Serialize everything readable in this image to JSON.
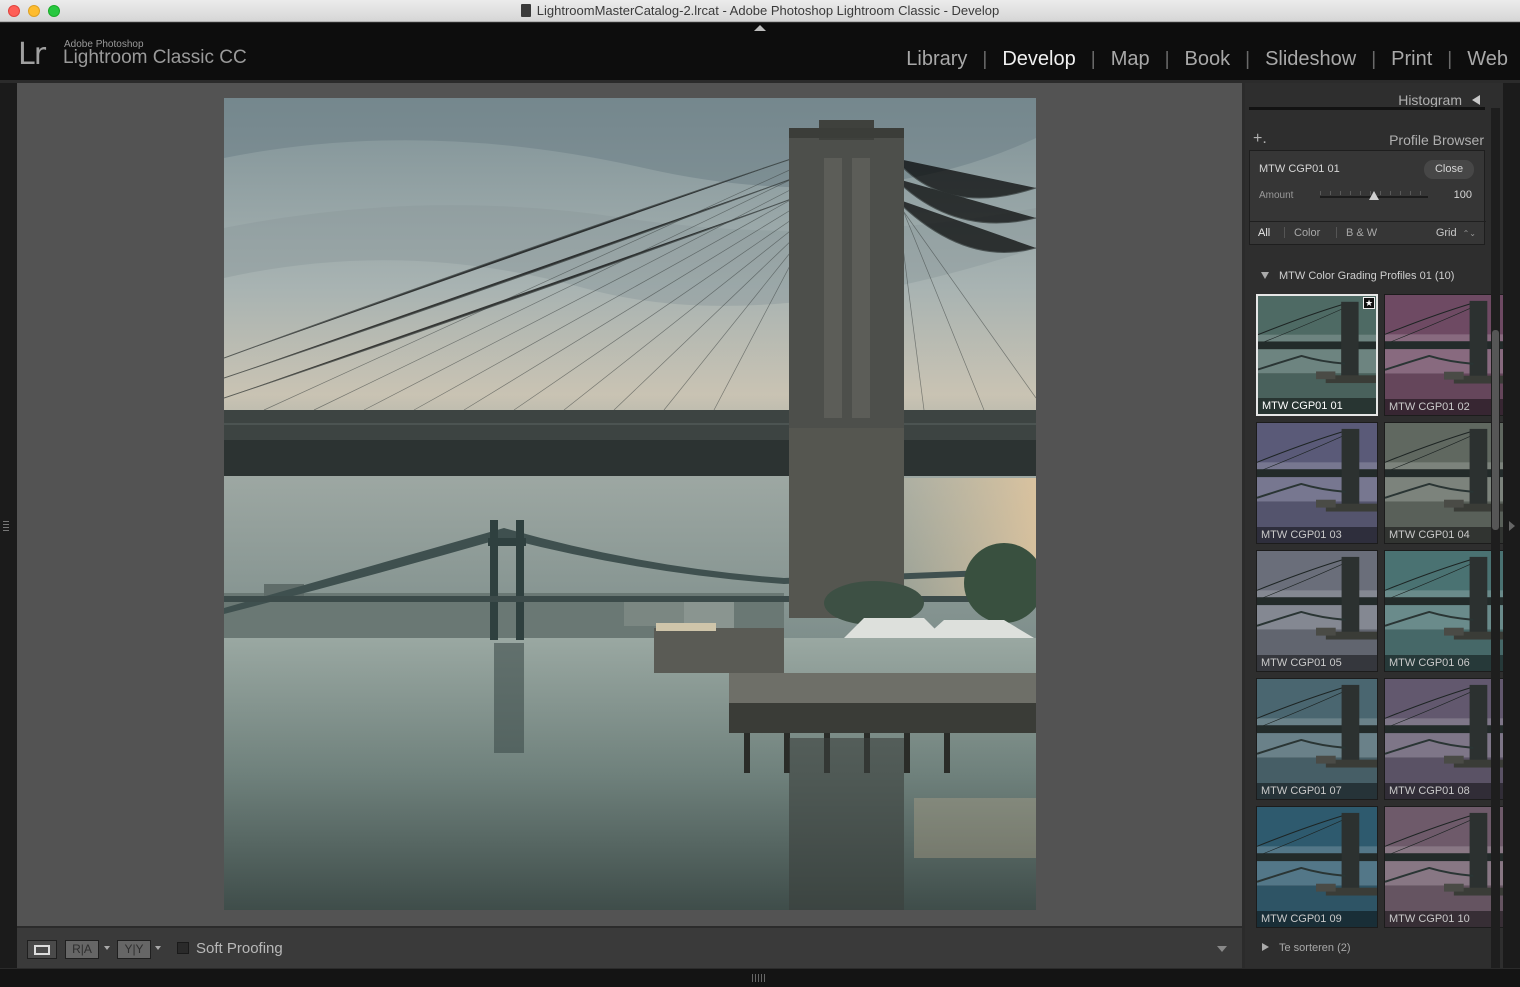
{
  "window": {
    "title": "LightroomMasterCatalog-2.lrcat - Adobe Photoshop Lightroom Classic - Develop"
  },
  "header": {
    "logo": "Lr",
    "brand_small": "Adobe Photoshop",
    "brand_big": "Lightroom Classic CC",
    "modules": [
      {
        "label": "Library",
        "active": false
      },
      {
        "label": "Develop",
        "active": true
      },
      {
        "label": "Map",
        "active": false
      },
      {
        "label": "Book",
        "active": false
      },
      {
        "label": "Slideshow",
        "active": false
      },
      {
        "label": "Print",
        "active": false
      },
      {
        "label": "Web",
        "active": false
      }
    ]
  },
  "toolbar": {
    "ra_label": "R|A",
    "yy_label": "Y|Y",
    "soft_proofing_label": "Soft Proofing",
    "soft_proofing_checked": false
  },
  "right_panel": {
    "histogram_label": "Histogram",
    "profile_browser_label": "Profile Browser",
    "add_label": "+.",
    "selected_profile": "MTW CGP01 01",
    "close_label": "Close",
    "amount_label": "Amount",
    "amount_value": "100",
    "amount_fraction": 0.5,
    "filters": [
      {
        "label": "All",
        "active": true
      },
      {
        "label": "Color",
        "active": false
      },
      {
        "label": "B & W",
        "active": false
      }
    ],
    "grid_label": "Grid",
    "groups": [
      {
        "label": "MTW Color Grading Profiles 01 (10)",
        "expanded": true,
        "profiles": [
          {
            "name": "MTW CGP01 01",
            "selected": true,
            "favorite": true,
            "tint": "#4e6a64"
          },
          {
            "name": "MTW CGP01 02",
            "selected": false,
            "favorite": false,
            "tint": "#6e4a63"
          },
          {
            "name": "MTW CGP01 03",
            "selected": false,
            "favorite": false,
            "tint": "#5a5a78"
          },
          {
            "name": "MTW CGP01 04",
            "selected": false,
            "favorite": false,
            "tint": "#606860"
          },
          {
            "name": "MTW CGP01 05",
            "selected": false,
            "favorite": false,
            "tint": "#6a6e7a"
          },
          {
            "name": "MTW CGP01 06",
            "selected": false,
            "favorite": false,
            "tint": "#4a7272"
          },
          {
            "name": "MTW CGP01 07",
            "selected": false,
            "favorite": false,
            "tint": "#4a6670"
          },
          {
            "name": "MTW CGP01 08",
            "selected": false,
            "favorite": false,
            "tint": "#62586e"
          },
          {
            "name": "MTW CGP01 09",
            "selected": false,
            "favorite": false,
            "tint": "#2e5a6e"
          },
          {
            "name": "MTW CGP01 10",
            "selected": false,
            "favorite": false,
            "tint": "#6e5a6a"
          }
        ]
      },
      {
        "label": "Te sorteren (2)",
        "expanded": false
      }
    ]
  }
}
